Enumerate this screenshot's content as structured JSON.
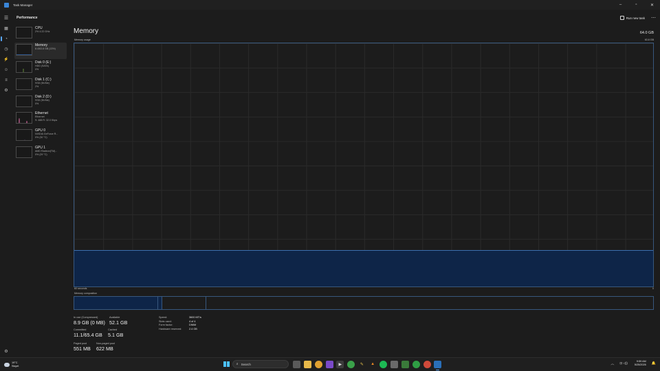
{
  "window": {
    "title": "Task Manager",
    "minimize": "–",
    "maximize": "▫",
    "close": "✕"
  },
  "header": {
    "section": "Performance",
    "run_new_task": "Run new task",
    "more": "⋯"
  },
  "nav": {
    "icons": [
      "menu-icon",
      "processes-icon",
      "performance-icon",
      "app-history-icon",
      "startup-apps-icon",
      "users-icon",
      "details-icon",
      "services-icon",
      "settings-icon"
    ]
  },
  "sidebar": {
    "devices": [
      {
        "name": "CPU",
        "sub1": "2% 4.22 GHz",
        "sub2": ""
      },
      {
        "name": "Memory",
        "sub1": "8.4/63.8 GB (13%)",
        "sub2": ""
      },
      {
        "name": "Disk 0 (E:)",
        "sub1": "HDD (SATA)",
        "sub2": "0%"
      },
      {
        "name": "Disk 1 (C:)",
        "sub1": "SSD (NVMe)",
        "sub2": "2%"
      },
      {
        "name": "Disk 2 (D:)",
        "sub1": "SSD (NVMe)",
        "sub2": "0%"
      },
      {
        "name": "Ethernet",
        "sub1": "Ethernet",
        "sub2": "S: 488 R: 32.0 Kbps"
      },
      {
        "name": "GPU 0",
        "sub1": "NVIDIA GeForce R...",
        "sub2": "0% (30 °C)"
      },
      {
        "name": "GPU 1",
        "sub1": "AMD Radeon(TM)...",
        "sub2": "0% (29 °C)"
      }
    ]
  },
  "memory": {
    "title": "Memory",
    "total": "64.0 GB",
    "usage_label": "Memory usage",
    "usage_max": "63.8 GB",
    "usage_fraction": 0.15,
    "time_left": "60 seconds",
    "time_right": "0",
    "composition_label": "Memory composition",
    "composition": {
      "in_use": 0.145,
      "modified": 0.007,
      "standby": 0.076
    },
    "stats": {
      "in_use_label": "In use (Compressed)",
      "in_use_value": "8.9 GB (0 MB)",
      "available_label": "Available",
      "available_value": "52.1 GB",
      "committed_label": "Committed",
      "committed_value": "11.1/65.4 GB",
      "cached_label": "Cached",
      "cached_value": "5.1 GB",
      "paged_pool_label": "Paged pool",
      "paged_pool_value": "551 MB",
      "non_paged_pool_label": "Non-paged pool",
      "non_paged_pool_value": "622 MB"
    },
    "specs": [
      {
        "k": "Speed:",
        "v": "3600 MT/s"
      },
      {
        "k": "Slots used:",
        "v": "4 of 4"
      },
      {
        "k": "Form factor:",
        "v": "DIMM"
      },
      {
        "k": "Hardware reserved:",
        "v": "2.4 GB"
      }
    ]
  },
  "taskbar": {
    "weather_temp": "19°C",
    "weather_desc": "Sisyet",
    "search_placeholder": "Search",
    "time": "9:59 AM",
    "date": "5/25/2026",
    "sys": "⊡ ◁))"
  }
}
